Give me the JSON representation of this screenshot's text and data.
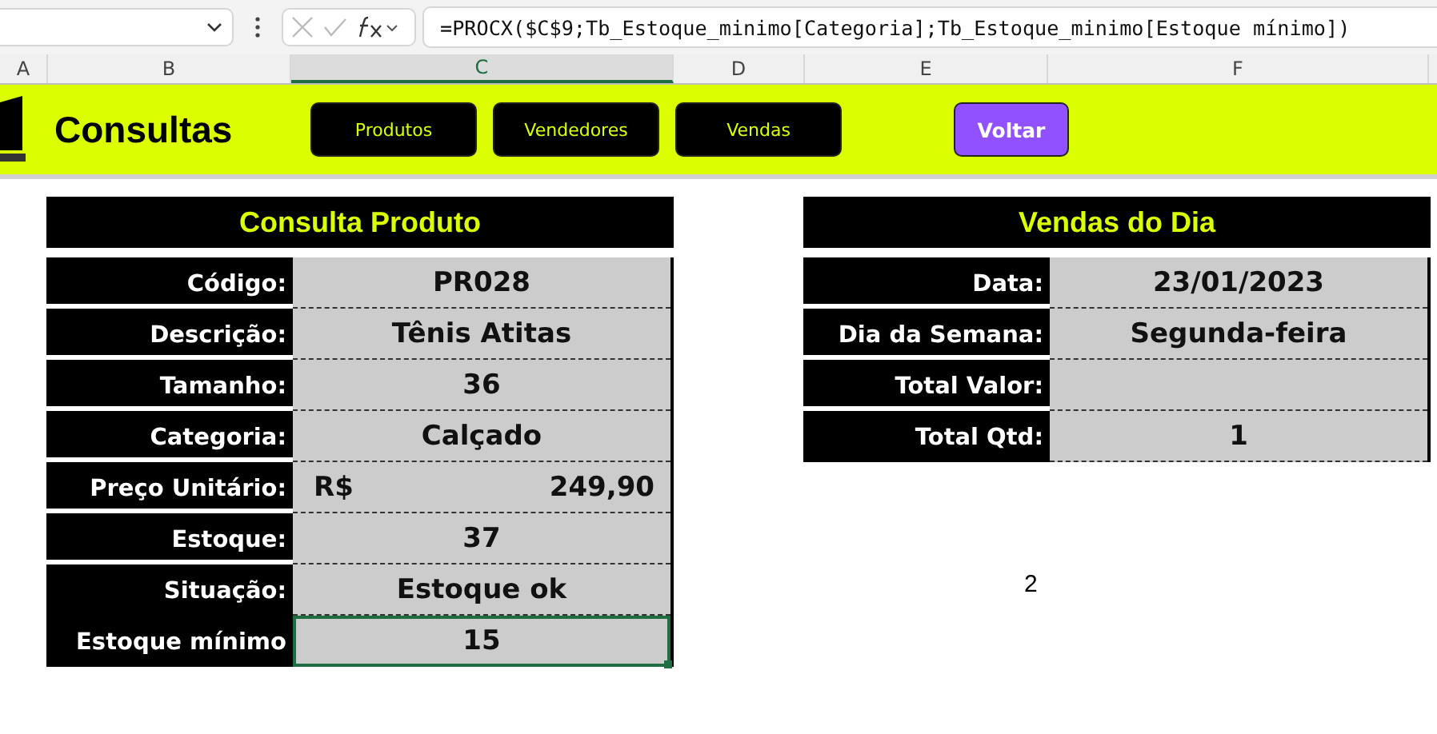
{
  "formula_bar": {
    "formula": "=PROCX($C$9;Tb_Estoque_minimo[Categoria];Tb_Estoque_minimo[Estoque mínimo])"
  },
  "column_headers": [
    {
      "label": "A",
      "selected": false
    },
    {
      "label": "B",
      "selected": false
    },
    {
      "label": "C",
      "selected": true
    },
    {
      "label": "D",
      "selected": false
    },
    {
      "label": "E",
      "selected": false
    },
    {
      "label": "F",
      "selected": false
    }
  ],
  "header": {
    "title": "Consultas",
    "buttons": [
      {
        "label": "Produtos",
        "kind": "nav"
      },
      {
        "label": "Vendedores",
        "kind": "nav"
      },
      {
        "label": "Vendas",
        "kind": "nav"
      },
      {
        "label": "Voltar",
        "kind": "back"
      }
    ]
  },
  "product_panel": {
    "title": "Consulta Produto",
    "rows": [
      {
        "label": "Código:",
        "value": "PR028",
        "selected": false
      },
      {
        "label": "Descrição:",
        "value": "Tênis Atitas",
        "selected": false
      },
      {
        "label": "Tamanho:",
        "value": "36",
        "selected": false
      },
      {
        "label": "Categoria:",
        "value": "Calçado",
        "selected": false
      },
      {
        "label": "Preço Unitário:",
        "currency": "R$",
        "value": "249,90",
        "selected": false
      },
      {
        "label": "Estoque:",
        "value": "37",
        "selected": false
      },
      {
        "label": "Situação:",
        "value": "Estoque ok",
        "selected": false
      },
      {
        "label": "Estoque mínimo",
        "value": "15",
        "selected": true
      }
    ]
  },
  "sales_panel": {
    "title": "Vendas do Dia",
    "rows": [
      {
        "label": "Data:",
        "value": "23/01/2023"
      },
      {
        "label": "Dia da Semana:",
        "value": "Segunda-feira"
      },
      {
        "label": "Total Valor:"
      },
      {
        "label": "Total Qtd:",
        "value": "1"
      }
    ]
  },
  "loose_cell": "2"
}
